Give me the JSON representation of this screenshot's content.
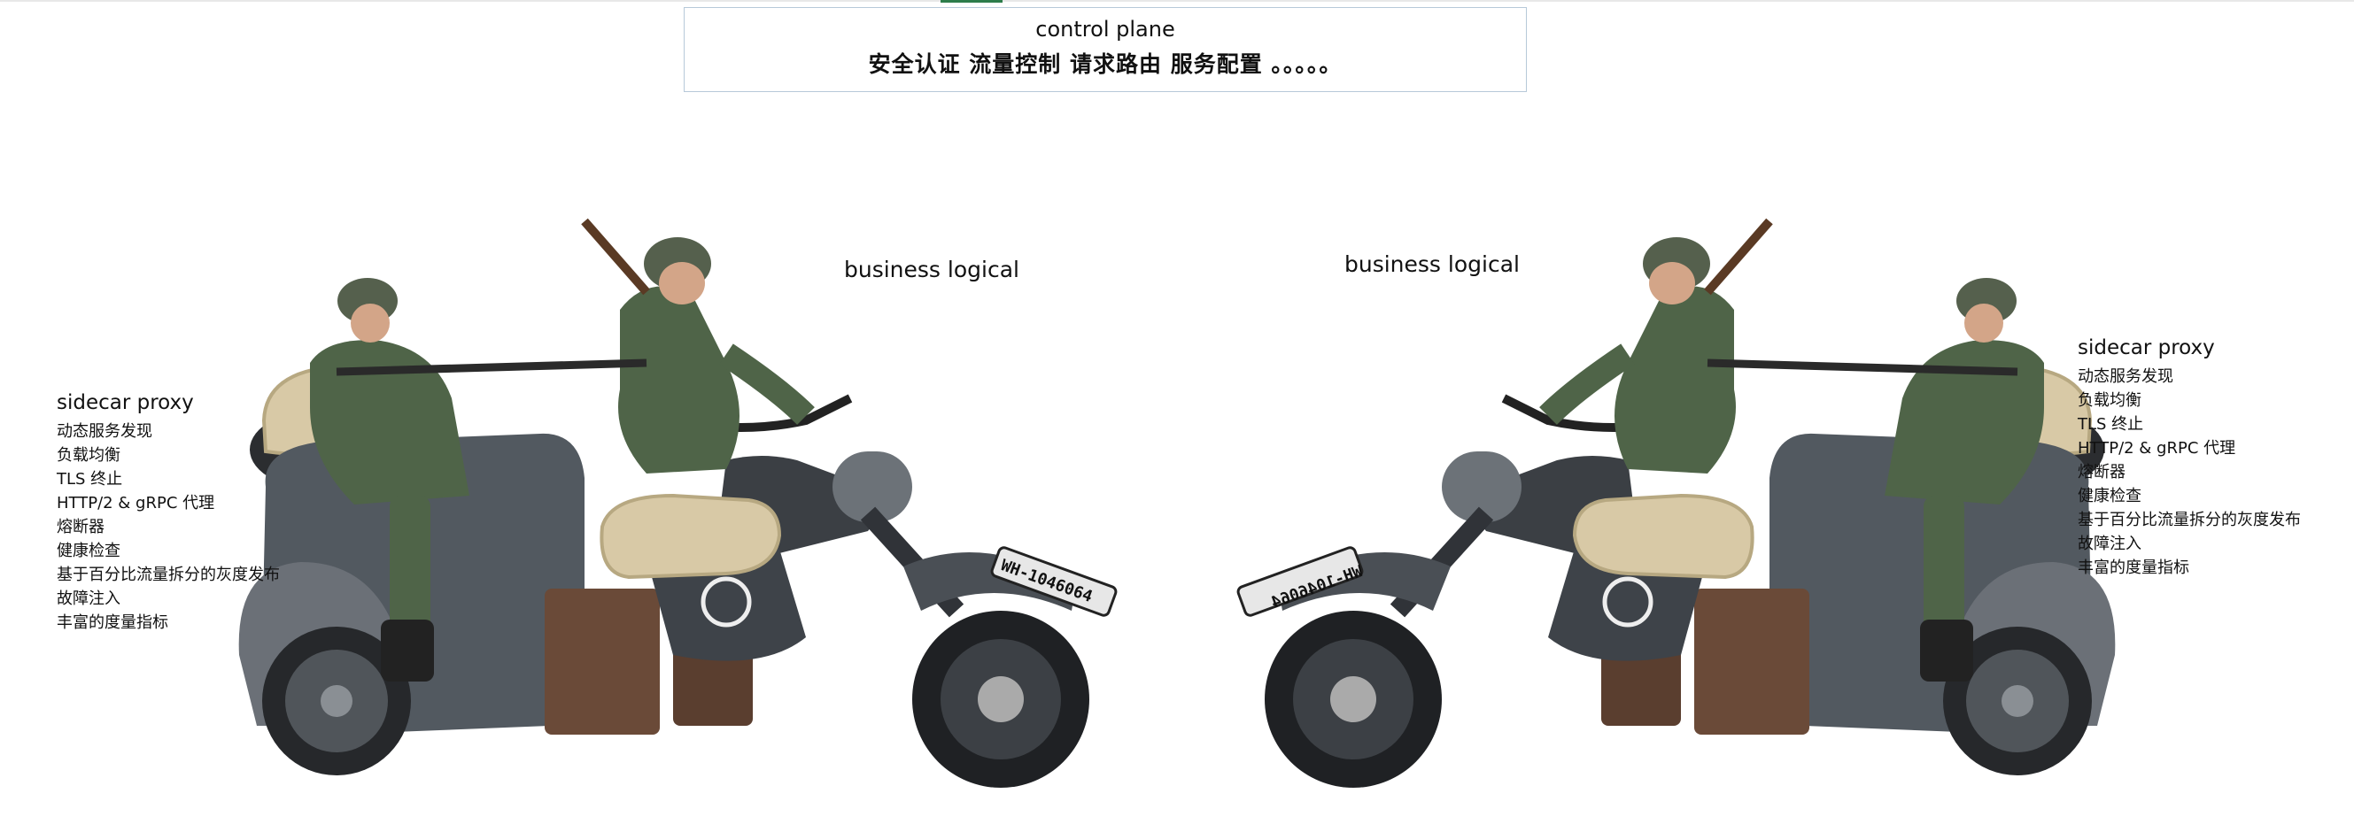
{
  "control_plane": {
    "title": "control plane",
    "subtitle": "安全认证 流量控制 请求路由 服务配置 。。。。。"
  },
  "left": {
    "business_label": "business logical",
    "sidecar": {
      "title": "sidecar proxy",
      "items": [
        "动态服务发现",
        "负载均衡",
        "TLS 终止",
        "HTTP/2 & gRPC 代理",
        "熔断器",
        "健康检查",
        "基于百分比流量拆分的灰度发布",
        "故障注入",
        "丰富的度量指标"
      ]
    },
    "plate": "WH-1046064"
  },
  "right": {
    "business_label": "business logical",
    "sidecar": {
      "title": "sidecar proxy",
      "items": [
        "动态服务发现",
        "负载均衡",
        "TLS 终止",
        "HTTP/2 & gRPC 代理",
        "熔断器",
        "健康检查",
        "基于百分比流量拆分的灰度发布",
        "故障注入",
        "丰富的度量指标"
      ]
    },
    "plate": "WH-1046064"
  },
  "colors": {
    "frame": "#b7c9d9",
    "uniform": "#4f6448",
    "helmet": "#55604d",
    "bike_body": "#3b3f44",
    "tire": "#2b2d30",
    "box": "#6a4a38",
    "bag": "#d8c9a6"
  }
}
